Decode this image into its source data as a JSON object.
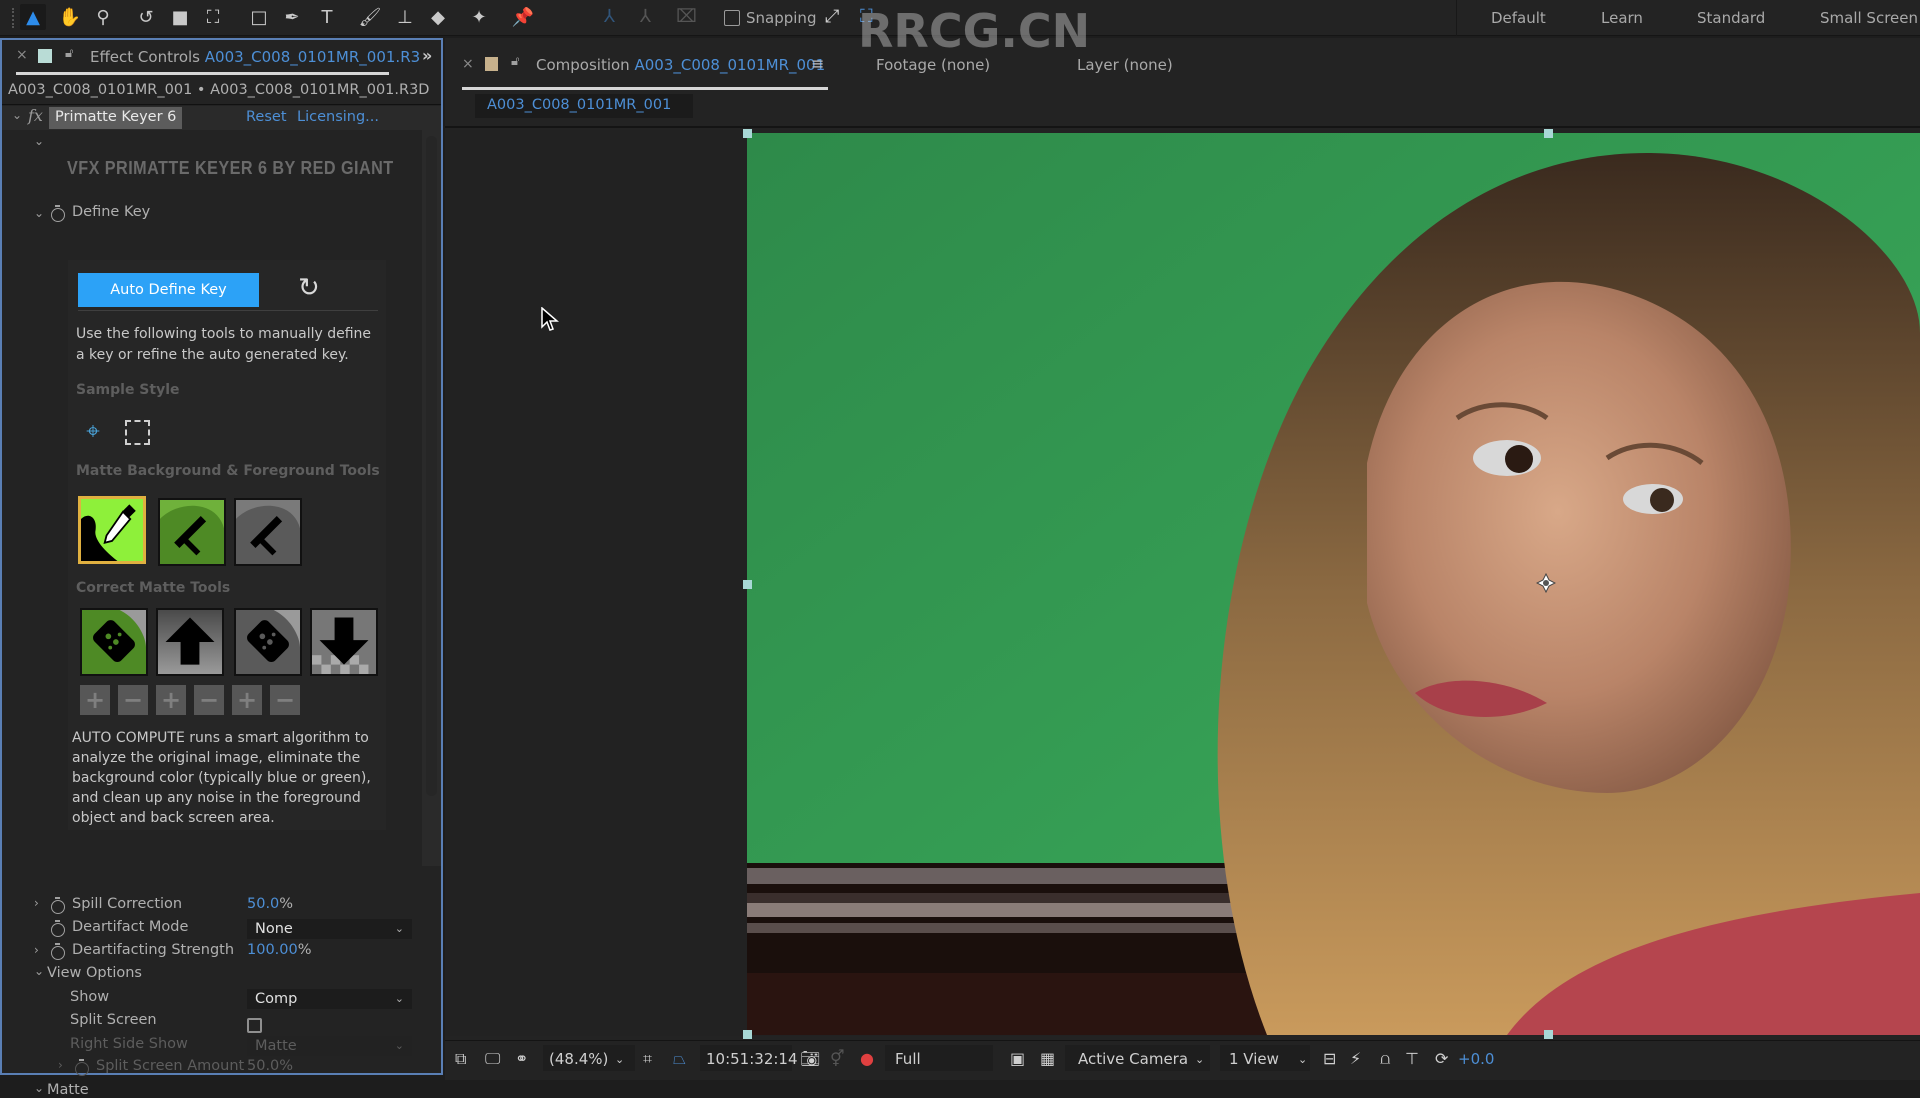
{
  "toolbar": {
    "tools": [
      {
        "name": "selection-tool",
        "glyph": "▲",
        "active": true
      },
      {
        "name": "hand-tool",
        "glyph": "✋"
      },
      {
        "name": "zoom-tool",
        "glyph": "⚲"
      },
      {
        "name": "rotation-tool",
        "glyph": "↺"
      },
      {
        "name": "camera-tool",
        "glyph": "■"
      },
      {
        "name": "pan-behind-tool",
        "glyph": "⛶"
      },
      {
        "name": "rectangle-tool",
        "glyph": "□"
      },
      {
        "name": "pen-tool",
        "glyph": "✒"
      },
      {
        "name": "type-tool",
        "glyph": "T"
      },
      {
        "name": "brush-tool",
        "glyph": "🖌"
      },
      {
        "name": "clone-stamp-tool",
        "glyph": "⊥"
      },
      {
        "name": "eraser-tool",
        "glyph": "◆"
      },
      {
        "name": "roto-brush-tool",
        "glyph": "✦"
      },
      {
        "name": "puppet-pin-tool",
        "glyph": "📌"
      }
    ],
    "snapping_label": "Snapping",
    "snapping_checked": false,
    "workspaces": [
      "Default",
      "Learn",
      "Standard",
      "Small Screen"
    ]
  },
  "effect_controls": {
    "tab_prefix": "Effect Controls",
    "tab_layer": "A003_C008_0101MR_001.R3",
    "subheader": "A003_C008_0101MR_001 • A003_C008_0101MR_001.R3D",
    "effect_name": "Primatte Keyer 6",
    "reset_label": "Reset",
    "licensing_label": "Licensing...",
    "plugin_title": "VFX PRIMATTE KEYER 6 BY RED GIANT",
    "define_key_label": "Define Key",
    "auto_define_key_label": "Auto Define Key",
    "manual_help": "Use the following tools to manually define a key or refine the auto generated key.",
    "sample_style_label": "Sample Style",
    "matte_tools_label": "Matte Background & Foreground Tools",
    "correct_tools_label": "Correct Matte Tools",
    "plus_minus": [
      "+",
      "−",
      "+",
      "−",
      "+",
      "−"
    ],
    "auto_compute_desc": "AUTO COMPUTE runs a smart algorithm to analyze the original image, eliminate the background color (typically blue or green), and clean up any noise in the foreground object and back screen area.",
    "properties": {
      "spill_correction": {
        "label": "Spill Correction",
        "value": "50.0",
        "unit": "%"
      },
      "deartifact_mode": {
        "label": "Deartifact Mode",
        "value": "None"
      },
      "deartifacting_strength": {
        "label": "Deartifacting Strength",
        "value": "100.00",
        "unit": "%"
      },
      "view_options": {
        "label": "View Options"
      },
      "show": {
        "label": "Show",
        "value": "Comp"
      },
      "split_screen": {
        "label": "Split Screen",
        "checked": false
      },
      "right_side_show": {
        "label": "Right Side Show",
        "value": "Matte"
      },
      "split_screen_amount": {
        "label": "Split Screen Amount",
        "value": "50.0%"
      },
      "matte": {
        "label": "Matte"
      }
    }
  },
  "composition": {
    "tab_prefix": "Composition",
    "tab_name": "A003_C008_0101MR_001",
    "footage_tab": "Footage (none)",
    "layer_tab": "Layer (none)",
    "breadcrumb": "A003_C008_0101MR_001"
  },
  "viewer_bar": {
    "zoom": "(48.4%)",
    "timecode": "10:51:32:14",
    "resolution": "Full",
    "camera": "Active Camera",
    "views": "1 View",
    "exposure": "+0.0"
  },
  "colors": {
    "accent_blue": "#2ca2f7",
    "link_blue": "#4d8fd6",
    "green_screen": "#2f8a4a",
    "panel_border": "#5a7fb5"
  }
}
